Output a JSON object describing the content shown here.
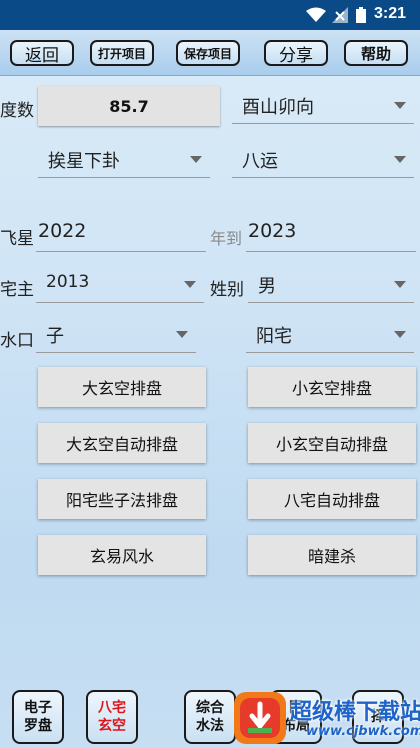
{
  "status_bar": {
    "time": "3:21"
  },
  "toolbar": {
    "back": "返回",
    "open_project": "打开项目",
    "save_project": "保存项目",
    "share": "分享",
    "help": "帮助"
  },
  "form": {
    "degree_label": "度数",
    "degree_value": "85.7",
    "direction": "酉山卯向",
    "star_mode": "挨星下卦",
    "period": "八运",
    "flying_star_label": "飞星",
    "start_year": "2022",
    "to_year_label": "年到",
    "end_year": "2023",
    "owner_label": "宅主",
    "owner_year": "2013",
    "gender_label": "姓别",
    "gender": "男",
    "water_label": "水口",
    "water": "子",
    "house_type": "阳宅"
  },
  "actions": [
    "大玄空排盘",
    "小玄空排盘",
    "大玄空自动排盘",
    "小玄空自动排盘",
    "阳宅些子法排盘",
    "八宅自动排盘",
    "玄易风水",
    "暗建杀"
  ],
  "bottom_nav": {
    "compass_line1": "电子",
    "compass_line2": "罗盘",
    "bazhai_line1": "八宅",
    "bazhai_line2": "玄空",
    "water_line1": "综合",
    "water_line2": "水法",
    "layout_line1": "阳",
    "layout_line2": "布局",
    "fifth_line1": "",
    "fifth_line2": "择"
  },
  "watermark": {
    "title": "超级棒下载站",
    "url": "www.cjbwk.com"
  },
  "colors": {
    "status_bar": "#0a4a86",
    "active_nav": "#e0141c",
    "watermark_text": "#1e63c8"
  }
}
